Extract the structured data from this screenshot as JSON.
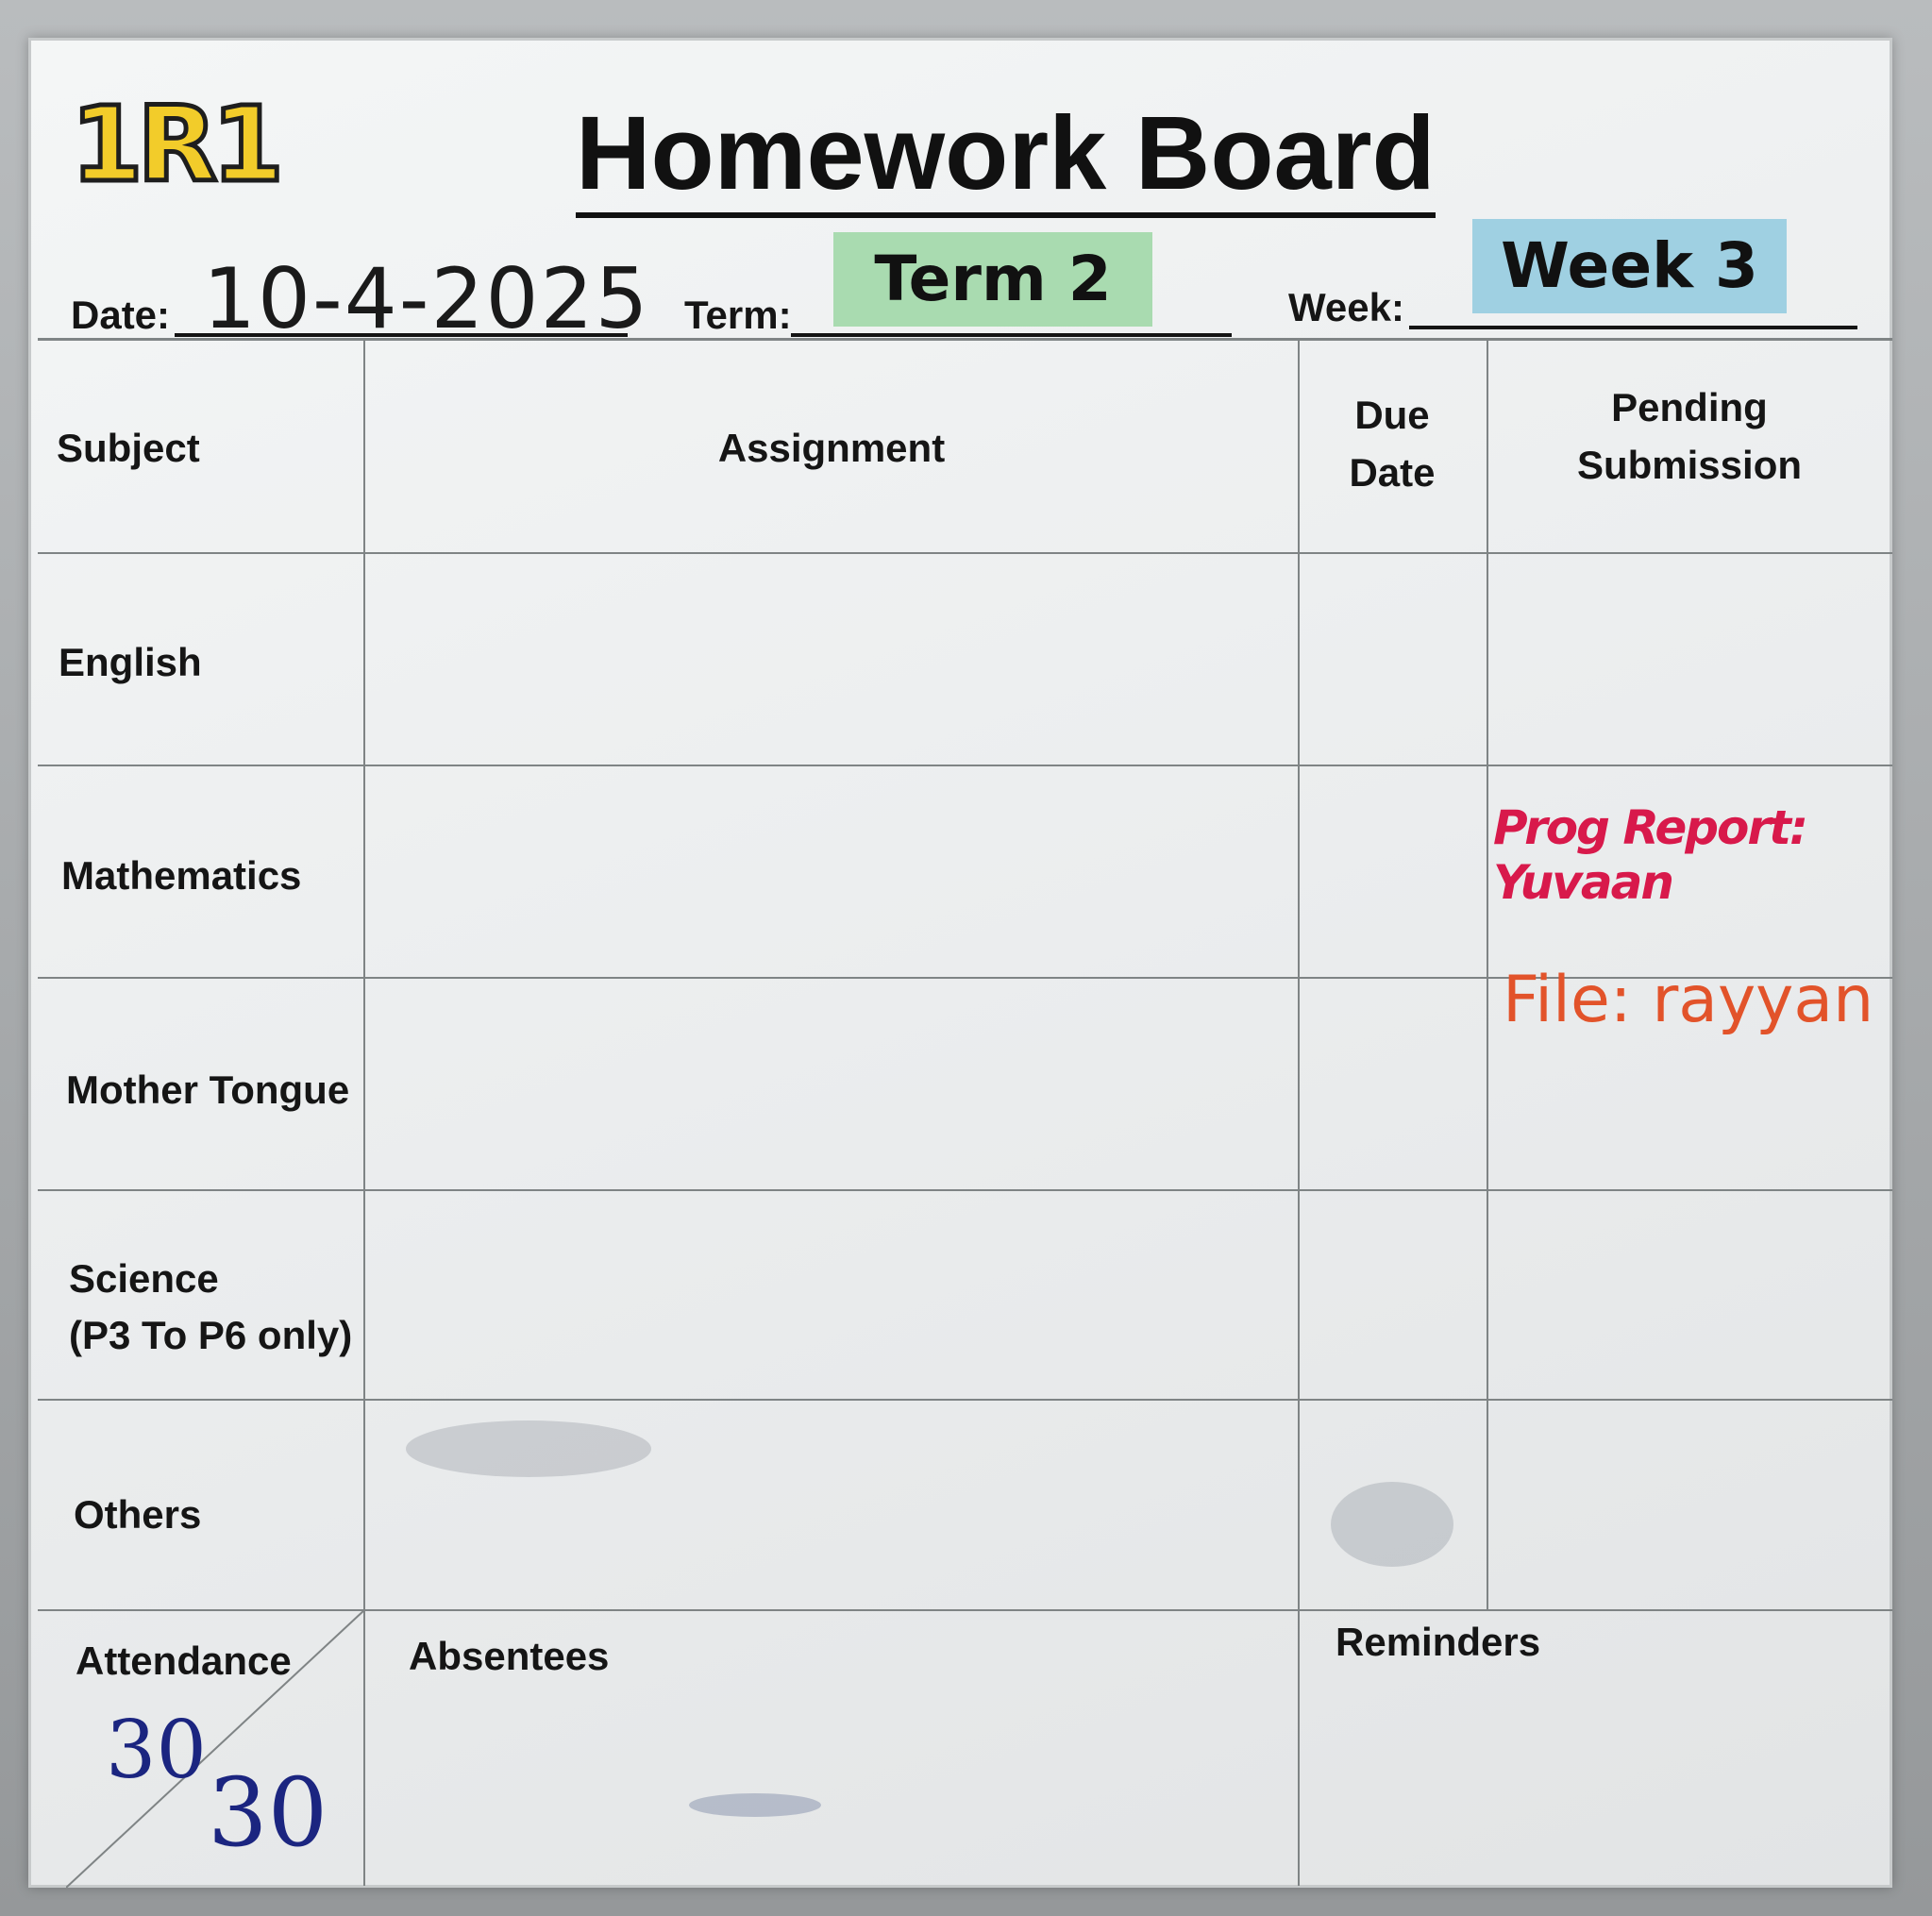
{
  "board": {
    "class_logo": "1R1",
    "title": "Homework Board",
    "date_label": "Date:",
    "date_value": "10-4-2025",
    "term_label": "Term:",
    "term_value": "Term 2",
    "week_label": "Week:",
    "week_value": "Week 3"
  },
  "table": {
    "headers": {
      "subject": "Subject",
      "assignment": "Assignment",
      "due_date": "Due Date",
      "pending_submission": "Pending Submission"
    },
    "rows": [
      {
        "subject": "English",
        "pending": ""
      },
      {
        "subject": "Mathematics",
        "pending": "Prog Report: Yuvaan"
      },
      {
        "subject": "Mother Tongue",
        "pending": "File: rayyan"
      },
      {
        "subject": "Science",
        "subject_note": "(P3 To P6 only)",
        "pending": ""
      },
      {
        "subject": "Others",
        "pending": ""
      }
    ]
  },
  "footer": {
    "attendance_label": "Attendance",
    "attendance_present": "30",
    "attendance_total": "30",
    "absentees_label": "Absentees",
    "reminders_label": "Reminders"
  },
  "colors": {
    "term_tag": "#a9dbb0",
    "week_tag": "#9fd0e2",
    "red_marker": "#d8194b",
    "orange_marker": "#e2532a",
    "blue_marker": "#1b2580",
    "logo_yellow": "#f2cc2a"
  }
}
